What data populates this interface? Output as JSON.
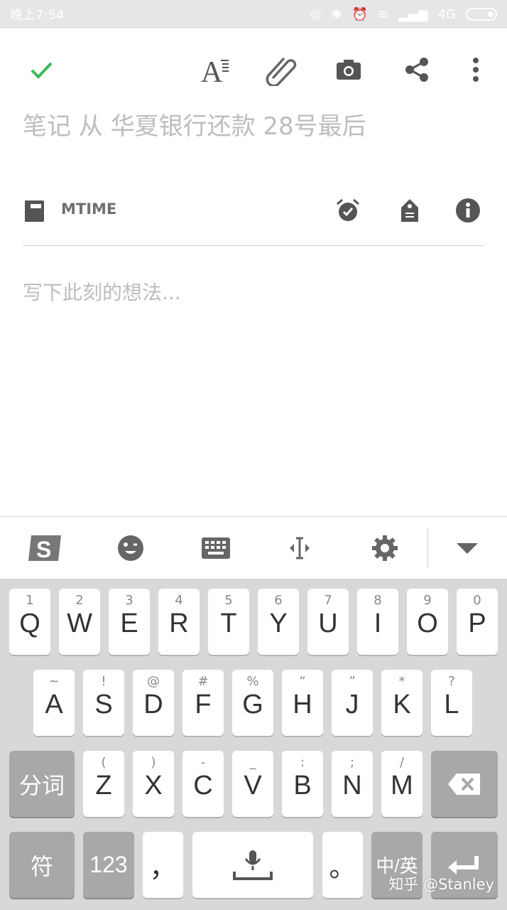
{
  "status_bar": {
    "time": "晚上7:54",
    "network": "4G"
  },
  "toolbar": {
    "confirm_icon": "check-icon",
    "format_icon": "text-format-icon",
    "attach_icon": "paperclip-icon",
    "camera_icon": "camera-icon",
    "share_icon": "share-icon",
    "more_icon": "more-vert-icon"
  },
  "note": {
    "title_placeholder": "笔记 从 华夏银行还款 28号最后",
    "notebook_name": "MTIME",
    "body_placeholder": "写下此刻的想法..."
  },
  "ime_bar": {
    "icons": [
      "sogou-logo-icon",
      "emoji-icon",
      "keyboard-icon",
      "cursor-move-icon",
      "settings-icon",
      "collapse-icon"
    ]
  },
  "keyboard": {
    "row1": [
      {
        "hint": "1",
        "label": "Q"
      },
      {
        "hint": "2",
        "label": "W"
      },
      {
        "hint": "3",
        "label": "E"
      },
      {
        "hint": "4",
        "label": "R"
      },
      {
        "hint": "5",
        "label": "T"
      },
      {
        "hint": "6",
        "label": "Y"
      },
      {
        "hint": "7",
        "label": "U"
      },
      {
        "hint": "8",
        "label": "I"
      },
      {
        "hint": "9",
        "label": "O"
      },
      {
        "hint": "0",
        "label": "P"
      }
    ],
    "row2": [
      {
        "hint": "~",
        "label": "A"
      },
      {
        "hint": "!",
        "label": "S"
      },
      {
        "hint": "@",
        "label": "D"
      },
      {
        "hint": "#",
        "label": "F"
      },
      {
        "hint": "%",
        "label": "G"
      },
      {
        "hint": "“",
        "label": "H"
      },
      {
        "hint": "”",
        "label": "J"
      },
      {
        "hint": "*",
        "label": "K"
      },
      {
        "hint": "?",
        "label": "L"
      }
    ],
    "row3": [
      {
        "hint": "(",
        "label": "Z"
      },
      {
        "hint": ")",
        "label": "X"
      },
      {
        "hint": "-",
        "label": "C"
      },
      {
        "hint": "_",
        "label": "V"
      },
      {
        "hint": ":",
        "label": "B"
      },
      {
        "hint": ";",
        "label": "N"
      },
      {
        "hint": "/",
        "label": "M"
      }
    ],
    "segment_label": "分词",
    "symbol_label": "符",
    "numeric_label": "123",
    "comma_label": "，",
    "period_label": "。",
    "lang_label": "中/英"
  },
  "watermark": "知乎 @Stanley"
}
